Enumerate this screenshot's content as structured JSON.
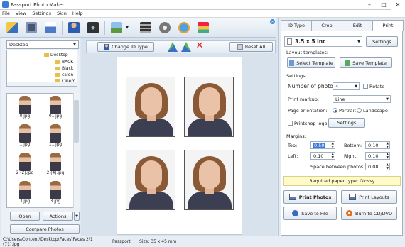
{
  "window": {
    "title": "Passport Photo Maker",
    "minimize": "–",
    "maximize": "□",
    "close": "✕"
  },
  "menu": [
    "File",
    "View",
    "Settings",
    "Skin",
    "Help"
  ],
  "colors": {
    "accent": "#3a7bd5",
    "panel_bg": "#dfe8f2",
    "notice_bg": "#fffbc8"
  },
  "toolbar": {
    "icons": [
      "open-icon",
      "save-icon",
      "print-icon",
      "person-icon",
      "camera-icon",
      "image-icon",
      "dropdown-arrow-icon",
      "film-icon",
      "gears-icon",
      "globe-icon",
      "boxes-icon"
    ]
  },
  "left": {
    "folder_select": "Desktop",
    "tree": [
      {
        "label": "Desktop",
        "level": 0
      },
      {
        "label": "BACK",
        "level": 1
      },
      {
        "label": "Black",
        "level": 1
      },
      {
        "label": "calen",
        "level": 1
      },
      {
        "label": "Cinem",
        "level": 1
      }
    ],
    "thumbs": [
      "0.jpg",
      "01.jpg",
      "1.jpg",
      "11.jpg",
      "2 (2).jpg",
      "2 (4).jpg",
      "3.jpg",
      "3.jpg"
    ],
    "open_label": "Open",
    "actions_label": "Actions",
    "compare_label": "Compare Photos"
  },
  "center": {
    "change_id_label": "Change ID Type",
    "reset_label": "Reset All"
  },
  "tabs": [
    "ID Type",
    "Crop",
    "Edit",
    "Print"
  ],
  "print": {
    "paper_size": "3.5 x 5 inc",
    "settings_btn": "Settings",
    "layout_templates_label": "Layout templates:",
    "select_template": "Select Template",
    "save_template": "Save Template",
    "settings_label": "Settings:",
    "num_photos_label": "Number of photos:",
    "num_photos": "4",
    "rotate_label": "Rotate",
    "print_markup_label": "Print markup:",
    "print_markup": "Line",
    "orientation_label": "Page orientation:",
    "portrait": "Portrait",
    "landscape": "Landscape",
    "printshop_label": "Printshop logo:",
    "printshop_settings": "Settings",
    "margins_label": "Margins:",
    "top_label": "Top:",
    "top_val": "0.50",
    "bottom_label": "Bottom:",
    "bottom_val": "0.10",
    "left_label": "Left:",
    "left_val": "0.10",
    "right_label": "Right:",
    "right_val": "0.10",
    "space_label": "Space between photos:",
    "space_val": "0.08",
    "paper_type": "Required paper type: Glossy",
    "print_photos": "Print Photos",
    "print_layouts": "Print Layouts",
    "save_file": "Save to File",
    "burn": "Burn to CD/DVD"
  },
  "status": {
    "path": "C:\\Users\\Content\\Desktop\\Faces\\Faces 2\\1 (71).jpg",
    "idtype": "Passport",
    "size": "Size: 35 x 45 mm"
  }
}
